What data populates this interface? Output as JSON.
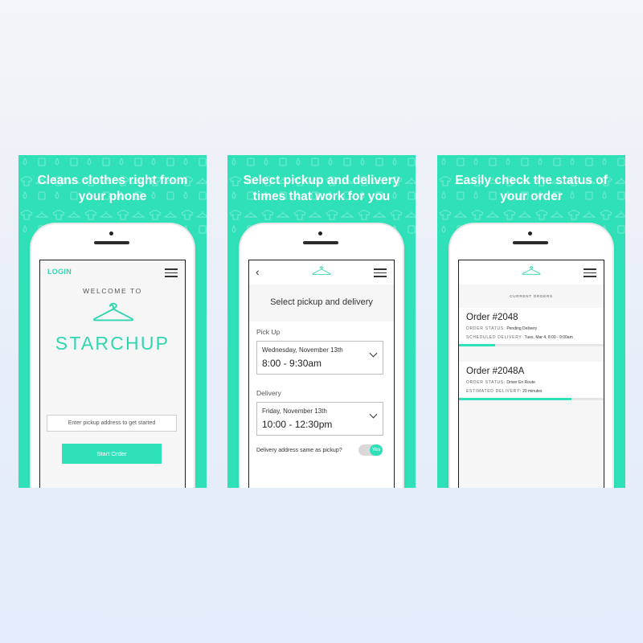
{
  "theme": {
    "accent": "#2fe0b9",
    "background": "#e7eef9"
  },
  "cards": [
    {
      "headline": "Cleans clothes right from your phone",
      "screen": {
        "login_label": "LOGIN",
        "menu_icon": "hamburger-icon",
        "welcome": "WELCOME TO",
        "logo_icon": "hanger-icon",
        "brand": "STARCHUP",
        "address_placeholder": "Enter pickup address to get started",
        "start_button": "Start Order"
      }
    },
    {
      "headline": "Select pickup and delivery times that work for you",
      "screen": {
        "back_icon": "chevron-left-icon",
        "logo_icon": "hanger-icon",
        "menu_icon": "hamburger-icon",
        "title": "Select pickup and delivery",
        "pickup_label": "Pick Up",
        "pickup_date": "Wednesday, November 13th",
        "pickup_time": "8:00 - 9:30am",
        "delivery_label": "Delivery",
        "delivery_date": "Friday, November 13th",
        "delivery_time": "10:00 - 12:30pm",
        "same_address_label": "Delivery address same as pickup?",
        "toggle_value": "Yes"
      }
    },
    {
      "headline": "Easily check the status of your order",
      "screen": {
        "logo_icon": "hanger-icon",
        "menu_icon": "hamburger-icon",
        "section_title": "CURRENT ORDERS",
        "orders": [
          {
            "title": "Order #2048",
            "status_key": "ORDER STATUS:",
            "status_value": "Pending Delivery",
            "time_key": "SCHEDULED DELIVERY:",
            "time_value": "Tues, Mar 4, 8:00 - 9:00am",
            "progress": 0.25
          },
          {
            "title": "Order #2048A",
            "status_key": "ORDER STATUS:",
            "status_value": "Driver En Route",
            "time_key": "ESTIMATED DELIVERY:",
            "time_value": "20 minutes",
            "progress": 0.78
          }
        ]
      }
    }
  ]
}
